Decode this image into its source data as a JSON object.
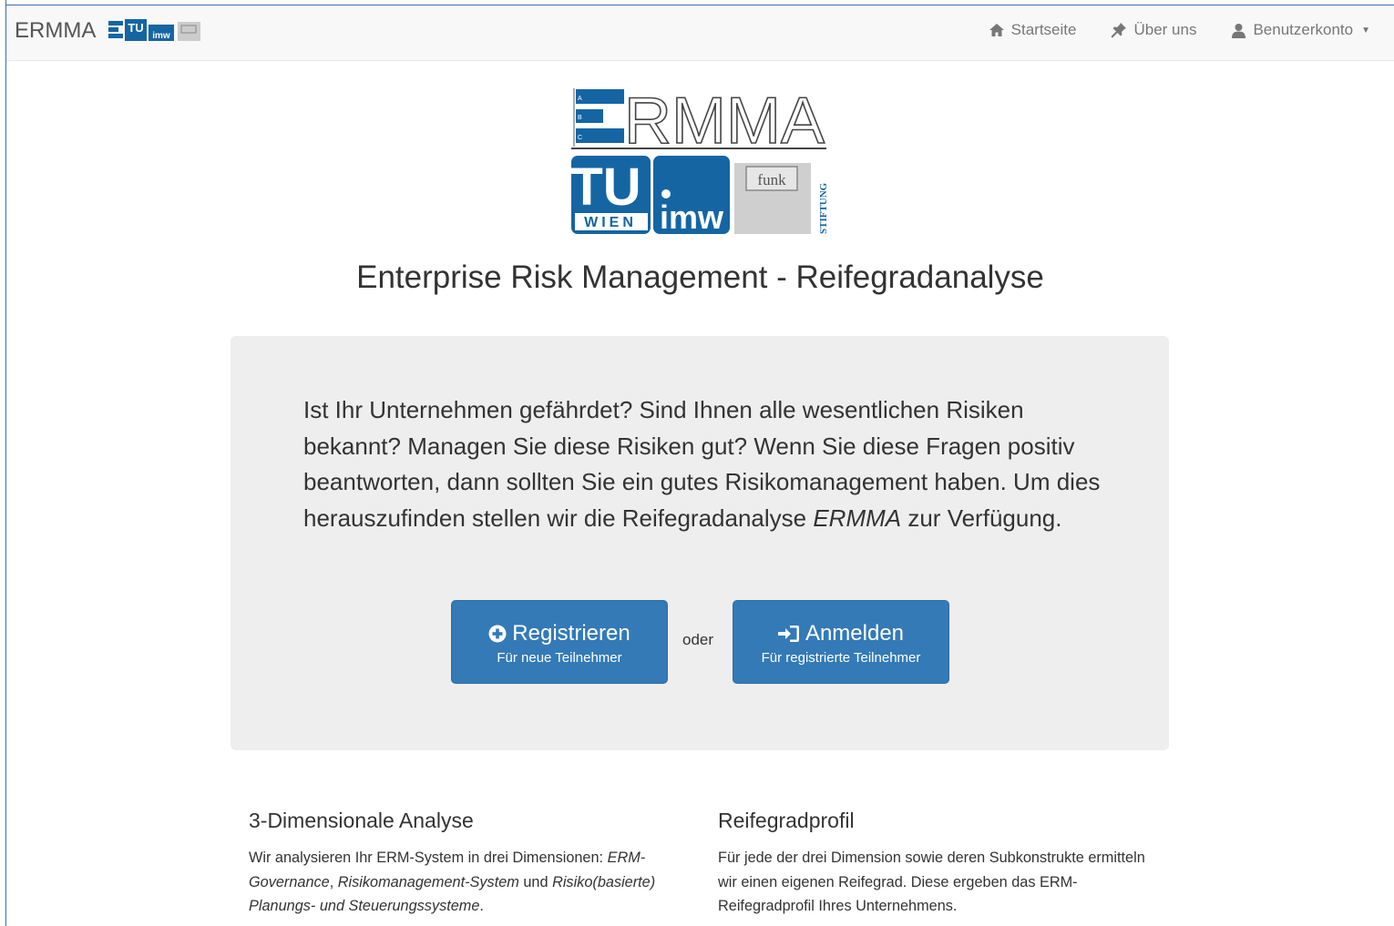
{
  "navbar": {
    "brand": "ERMMA",
    "links": [
      {
        "label": "Startseite",
        "icon": "home-icon"
      },
      {
        "label": "Über uns",
        "icon": "pushpin-icon"
      },
      {
        "label": "Benutzerkonto",
        "icon": "user-icon"
      }
    ]
  },
  "logo": {
    "title": "ERMMA",
    "tu_text": "TU",
    "wien_text": "WIEN",
    "imw_text": "imw",
    "funk_text": "funk",
    "stiftung_text": "STIFTUNG",
    "index_letters": [
      "A",
      "B",
      "C"
    ]
  },
  "title": "Enterprise Risk Management - Reifegradanalyse",
  "jumbotron": {
    "text_main": "Ist Ihr Unternehmen gefährdet? Sind Ihnen alle wesentlichen Risiken bekannt? Managen Sie diese Risiken gut? Wenn Sie diese Fragen positiv beantworten, dann sollten Sie ein gutes Risikomanagement haben. Um dies herauszufinden stellen wir die Reifegradanalyse ",
    "text_em": "ERMMA",
    "text_tail": " zur Verfügung.",
    "register": {
      "label": "Registrieren",
      "sub": "Für neue Teilnehmer"
    },
    "or_label": "oder",
    "login": {
      "label": "Anmelden",
      "sub": "Für registrierte Teilnehmer"
    }
  },
  "features": [
    {
      "title": "3-Dimensionale Analyse",
      "p1": "Wir analysieren Ihr ERM-System in drei Dimensionen: ",
      "em1": "ERM-Governance",
      "p2": ", ",
      "em2": "Risikomanagement-System",
      "p3": " und ",
      "em3": "Risiko(basierte) Planungs- und Steuerungssysteme",
      "p4": "."
    },
    {
      "title": "Reifegradprofil",
      "text": "Für jede der drei Dimension sowie deren Subkonstrukte ermitteln wir einen eigenen Reifegrad. Diese ergeben das ERM-Reifegradprofil Ihres Unternehmens."
    }
  ],
  "colors": {
    "primary": "#337ab7",
    "jumbotron_bg": "#eeeeee",
    "logo_blue": "#1565a3",
    "navbar_bg": "#f8f8f8"
  }
}
